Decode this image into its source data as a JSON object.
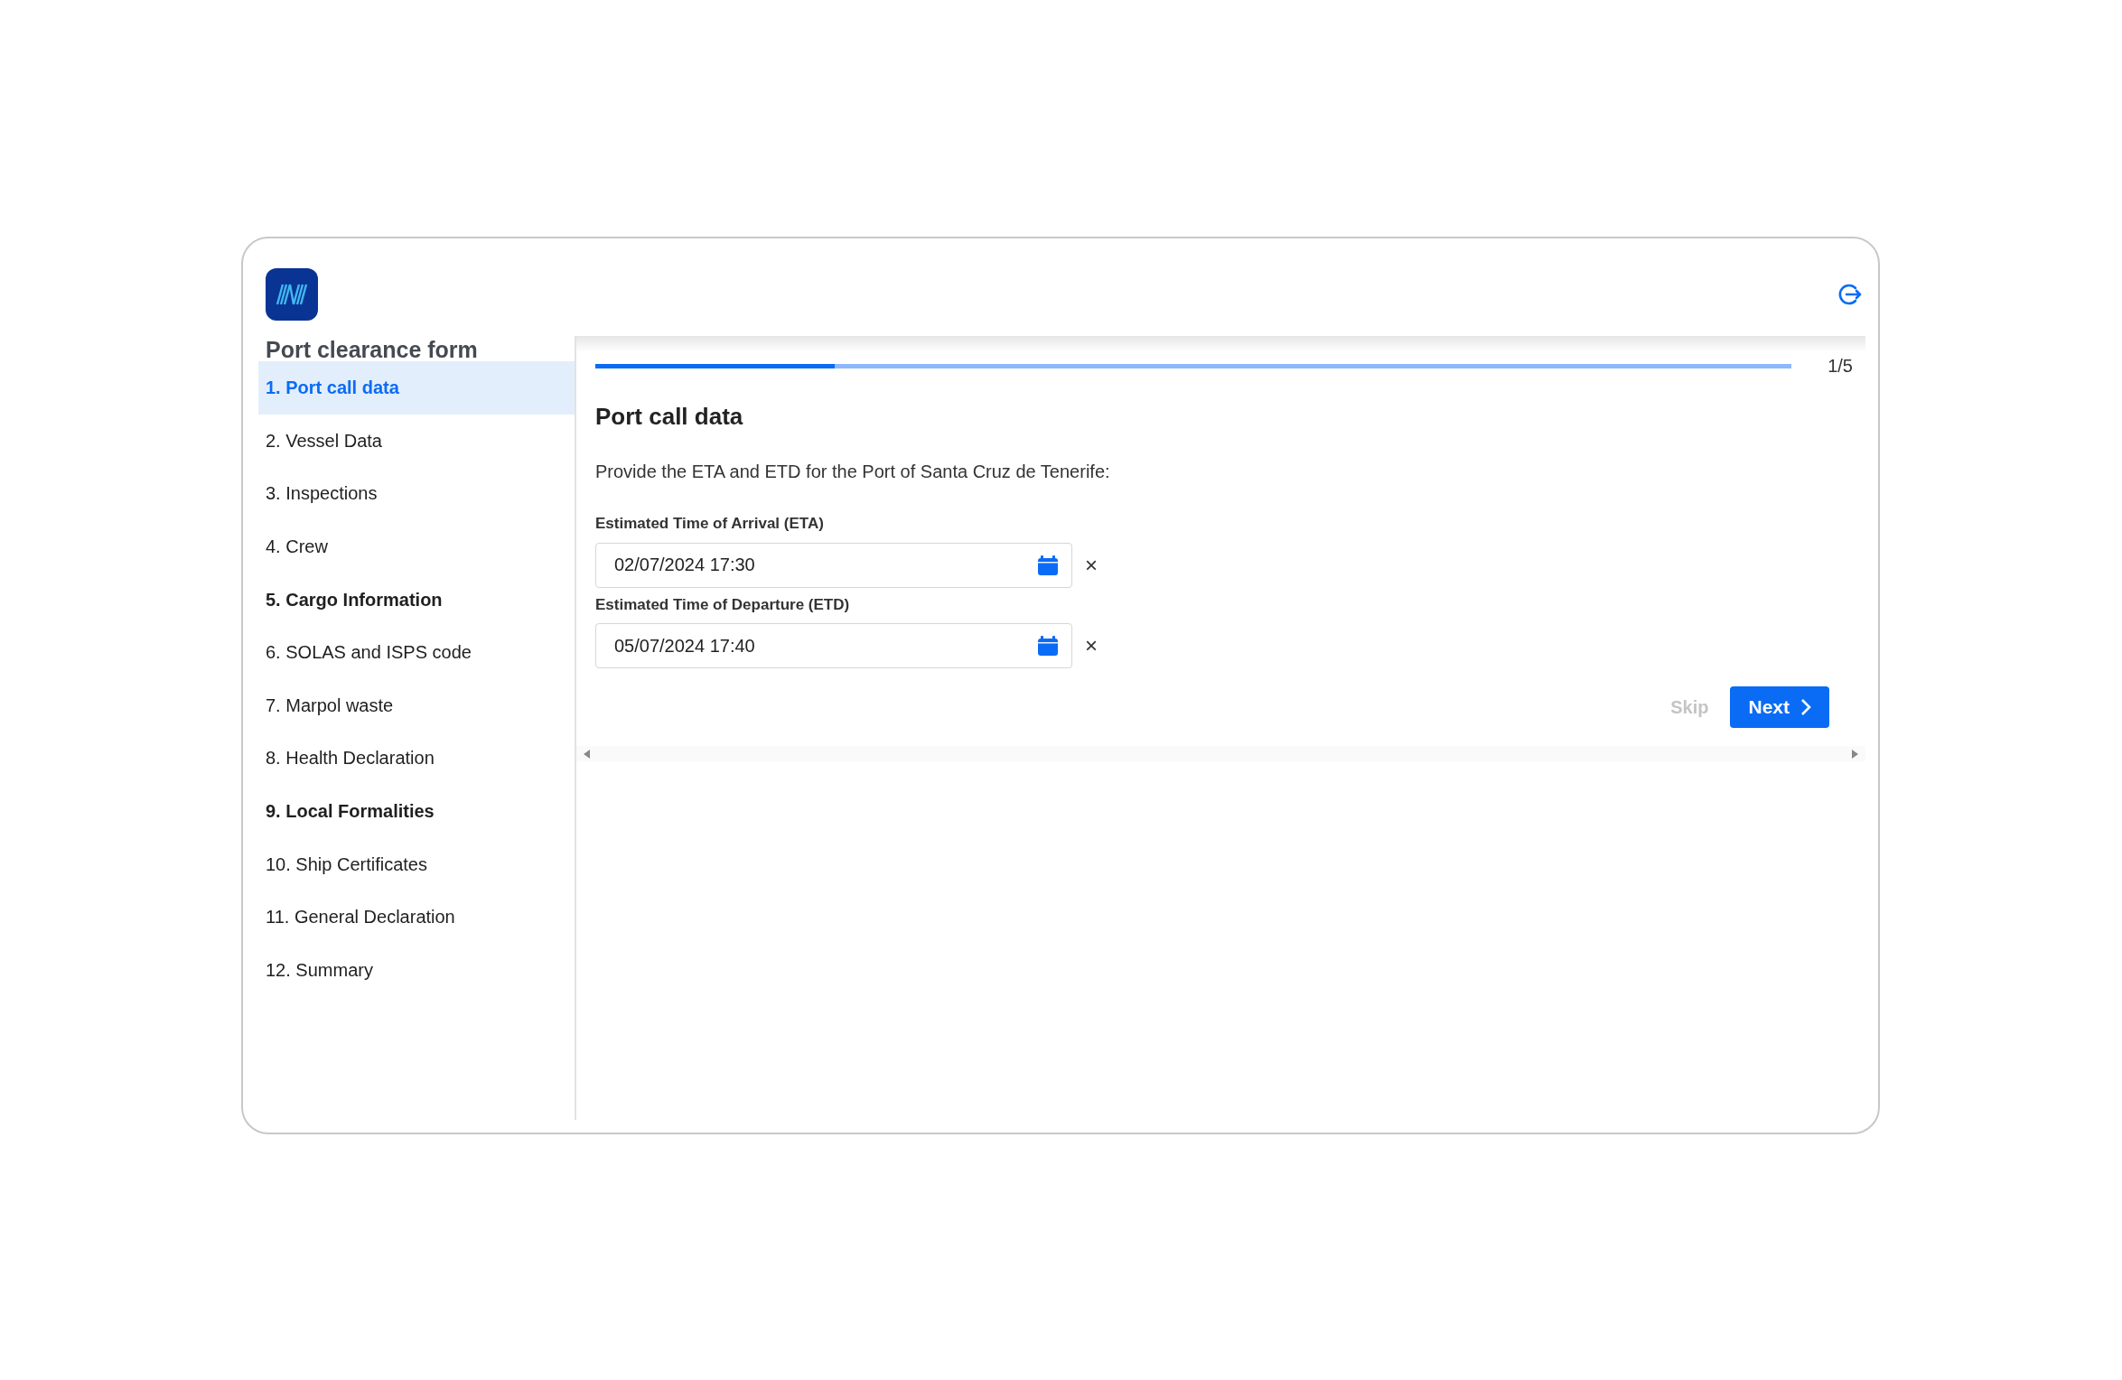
{
  "app": {
    "title": "Port clearance form"
  },
  "steps": [
    {
      "label": "1. Port call data",
      "selected": true,
      "emphasized": true
    },
    {
      "label": "2. Vessel Data",
      "selected": false,
      "emphasized": false
    },
    {
      "label": "3. Inspections",
      "selected": false,
      "emphasized": false
    },
    {
      "label": "4. Crew",
      "selected": false,
      "emphasized": false
    },
    {
      "label": "5. Cargo Information",
      "selected": false,
      "emphasized": true
    },
    {
      "label": "6. SOLAS and ISPS code",
      "selected": false,
      "emphasized": false
    },
    {
      "label": "7. Marpol waste",
      "selected": false,
      "emphasized": false
    },
    {
      "label": "8. Health Declaration",
      "selected": false,
      "emphasized": false
    },
    {
      "label": "9. Local Formalities",
      "selected": false,
      "emphasized": true
    },
    {
      "label": "10. Ship Certificates",
      "selected": false,
      "emphasized": false
    },
    {
      "label": "11. General Declaration",
      "selected": false,
      "emphasized": false
    },
    {
      "label": "12. Summary",
      "selected": false,
      "emphasized": false
    }
  ],
  "progress": {
    "level": 0.2,
    "counter": "1/5"
  },
  "section": {
    "heading": "Port call data",
    "instruction": "Provide the ETA and ETD for the Port of Santa Cruz de Tenerife:",
    "fields": [
      {
        "label": "Estimated Time of Arrival (ETA)",
        "value": "02/07/2024 17:30",
        "clear": "×"
      },
      {
        "label": "Estimated Time of Departure (ETD)",
        "value": "05/07/2024 17:40",
        "clear": "×"
      }
    ]
  },
  "actions": {
    "skip": {
      "label": "Skip",
      "disabled": true
    },
    "next": {
      "label": "Next"
    }
  }
}
